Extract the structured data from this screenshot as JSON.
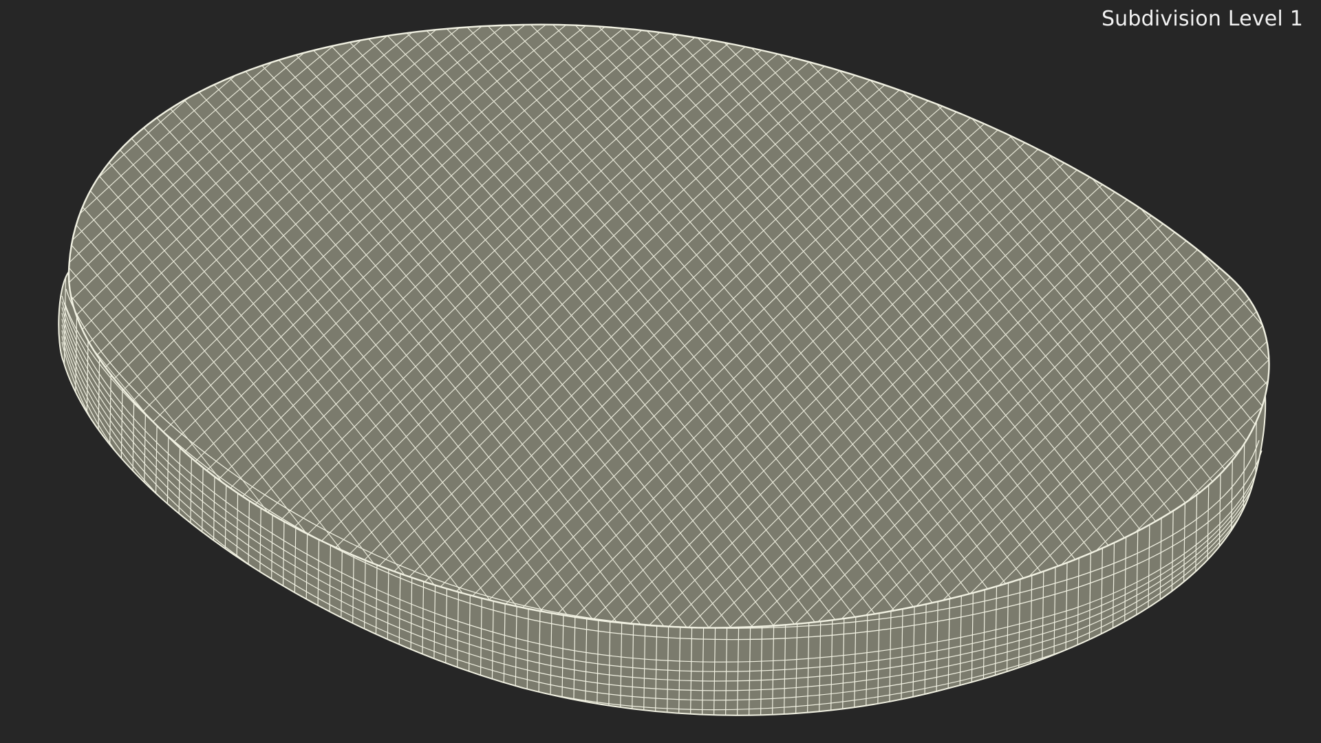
{
  "viewport": {
    "label": "Subdivision Level 1",
    "mesh_name": "oval-cushion-wireframe",
    "colors": {
      "background": "#262626",
      "surface": "#7b7b6d",
      "wire": "#f1f1e2",
      "label": "#f2f2f2"
    }
  }
}
